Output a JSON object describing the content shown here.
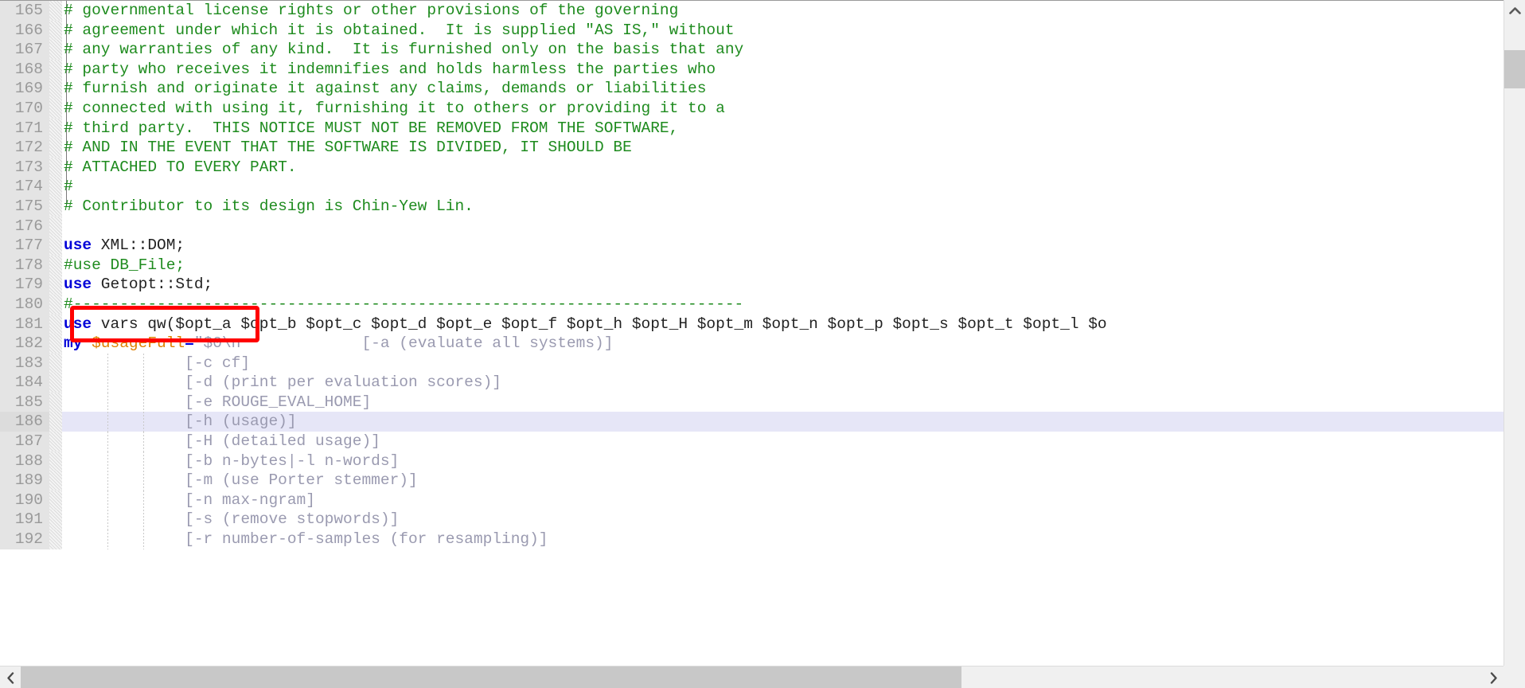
{
  "editor": {
    "language": "perl",
    "first_visible_line": 165,
    "last_visible_line": 192,
    "current_line": 186,
    "colors": {
      "comment": "#1E8B1E",
      "keyword": "#0000D8",
      "variable": "#E08000",
      "string": "#9a9ab0",
      "gutter_bg": "#E4E4E4",
      "gutter_fg": "#9a9a9a",
      "current_line_bg": "#E6E6F7",
      "annotation_border": "#FF0000",
      "scrollbar_thumb": "#C8C8C8"
    },
    "lines": [
      {
        "n": "165",
        "tokens": [
          {
            "t": "# governmental license rights or other provisions of the governing",
            "c": "cmt"
          }
        ]
      },
      {
        "n": "166",
        "tokens": [
          {
            "t": "# agreement under which it is obtained.  It is supplied \"AS IS,\" without",
            "c": "cmt"
          }
        ]
      },
      {
        "n": "167",
        "tokens": [
          {
            "t": "# any warranties of any kind.  It is furnished only on the basis that any",
            "c": "cmt"
          }
        ]
      },
      {
        "n": "168",
        "tokens": [
          {
            "t": "# party who receives it indemnifies and holds harmless the parties who",
            "c": "cmt"
          }
        ]
      },
      {
        "n": "169",
        "tokens": [
          {
            "t": "# furnish and originate it against any claims, demands or liabilities",
            "c": "cmt"
          }
        ]
      },
      {
        "n": "170",
        "tokens": [
          {
            "t": "# connected with using it, furnishing it to others or providing it to a",
            "c": "cmt"
          }
        ]
      },
      {
        "n": "171",
        "tokens": [
          {
            "t": "# third party.  THIS NOTICE MUST NOT BE REMOVED FROM THE SOFTWARE,",
            "c": "cmt"
          }
        ]
      },
      {
        "n": "172",
        "tokens": [
          {
            "t": "# AND IN THE EVENT THAT THE SOFTWARE IS DIVIDED, IT SHOULD BE",
            "c": "cmt"
          }
        ]
      },
      {
        "n": "173",
        "tokens": [
          {
            "t": "# ATTACHED TO EVERY PART.",
            "c": "cmt"
          }
        ]
      },
      {
        "n": "174",
        "tokens": [
          {
            "t": "#",
            "c": "cmt"
          }
        ]
      },
      {
        "n": "175",
        "tokens": [
          {
            "t": "# Contributor to its design is Chin-Yew Lin.",
            "c": "cmt"
          }
        ]
      },
      {
        "n": "176",
        "tokens": []
      },
      {
        "n": "177",
        "tokens": [
          {
            "t": "use",
            "c": "kw"
          },
          {
            "t": " XML::DOM;",
            "c": "plain"
          }
        ]
      },
      {
        "n": "178",
        "tokens": [
          {
            "t": "#use DB_File;",
            "c": "cmt"
          }
        ]
      },
      {
        "n": "179",
        "tokens": [
          {
            "t": "use",
            "c": "kw"
          },
          {
            "t": " Getopt::Std;",
            "c": "plain"
          }
        ]
      },
      {
        "n": "180",
        "tokens": [
          {
            "t": "#------------------------------------------------------------------------",
            "c": "cmt"
          }
        ]
      },
      {
        "n": "181",
        "tokens": [
          {
            "t": "use",
            "c": "kw"
          },
          {
            "t": " vars qw($opt_a $opt_b $opt_c $opt_d $opt_e $opt_f $opt_h $opt_H $opt_m $opt_n $opt_p $opt_s $opt_t $opt_l $o",
            "c": "plain"
          }
        ]
      },
      {
        "n": "182",
        "tokens": [
          {
            "t": "my",
            "c": "kw"
          },
          {
            "t": " ",
            "c": "plain"
          },
          {
            "t": "$usageFull",
            "c": "var"
          },
          {
            "t": "=",
            "c": "op"
          },
          {
            "t": "\"$0\\n             [-a (evaluate all systems)]",
            "c": "str"
          }
        ]
      },
      {
        "n": "183",
        "tokens": [
          {
            "t": "             [-c cf]",
            "c": "str"
          }
        ]
      },
      {
        "n": "184",
        "tokens": [
          {
            "t": "             [-d (print per evaluation scores)]",
            "c": "str"
          }
        ]
      },
      {
        "n": "185",
        "tokens": [
          {
            "t": "             [-e ROUGE_EVAL_HOME]",
            "c": "str"
          }
        ]
      },
      {
        "n": "186",
        "tokens": [
          {
            "t": "             [-h (usage)]",
            "c": "str"
          }
        ]
      },
      {
        "n": "187",
        "tokens": [
          {
            "t": "             [-H (detailed usage)]",
            "c": "str"
          }
        ]
      },
      {
        "n": "188",
        "tokens": [
          {
            "t": "             [-b n-bytes|-l n-words]",
            "c": "str"
          }
        ]
      },
      {
        "n": "189",
        "tokens": [
          {
            "t": "             [-m (use Porter stemmer)]",
            "c": "str"
          }
        ]
      },
      {
        "n": "190",
        "tokens": [
          {
            "t": "             [-n max-ngram]",
            "c": "str"
          }
        ]
      },
      {
        "n": "191",
        "tokens": [
          {
            "t": "             [-s (remove stopwords)]",
            "c": "str"
          }
        ]
      },
      {
        "n": "192",
        "tokens": [
          {
            "t": "             [-r number-of-samples (for resampling)]",
            "c": "str"
          }
        ]
      }
    ]
  },
  "annotation": {
    "target_line": "178",
    "target_text": "#use DB_File;",
    "shape": "rectangle",
    "color": "#FF0000"
  },
  "scrollbars": {
    "vertical": {
      "up_icon": "chevron-up-icon",
      "down_icon": "chevron-down-icon"
    },
    "horizontal": {
      "left_icon": "chevron-left-icon",
      "right_icon": "chevron-right-icon"
    }
  }
}
